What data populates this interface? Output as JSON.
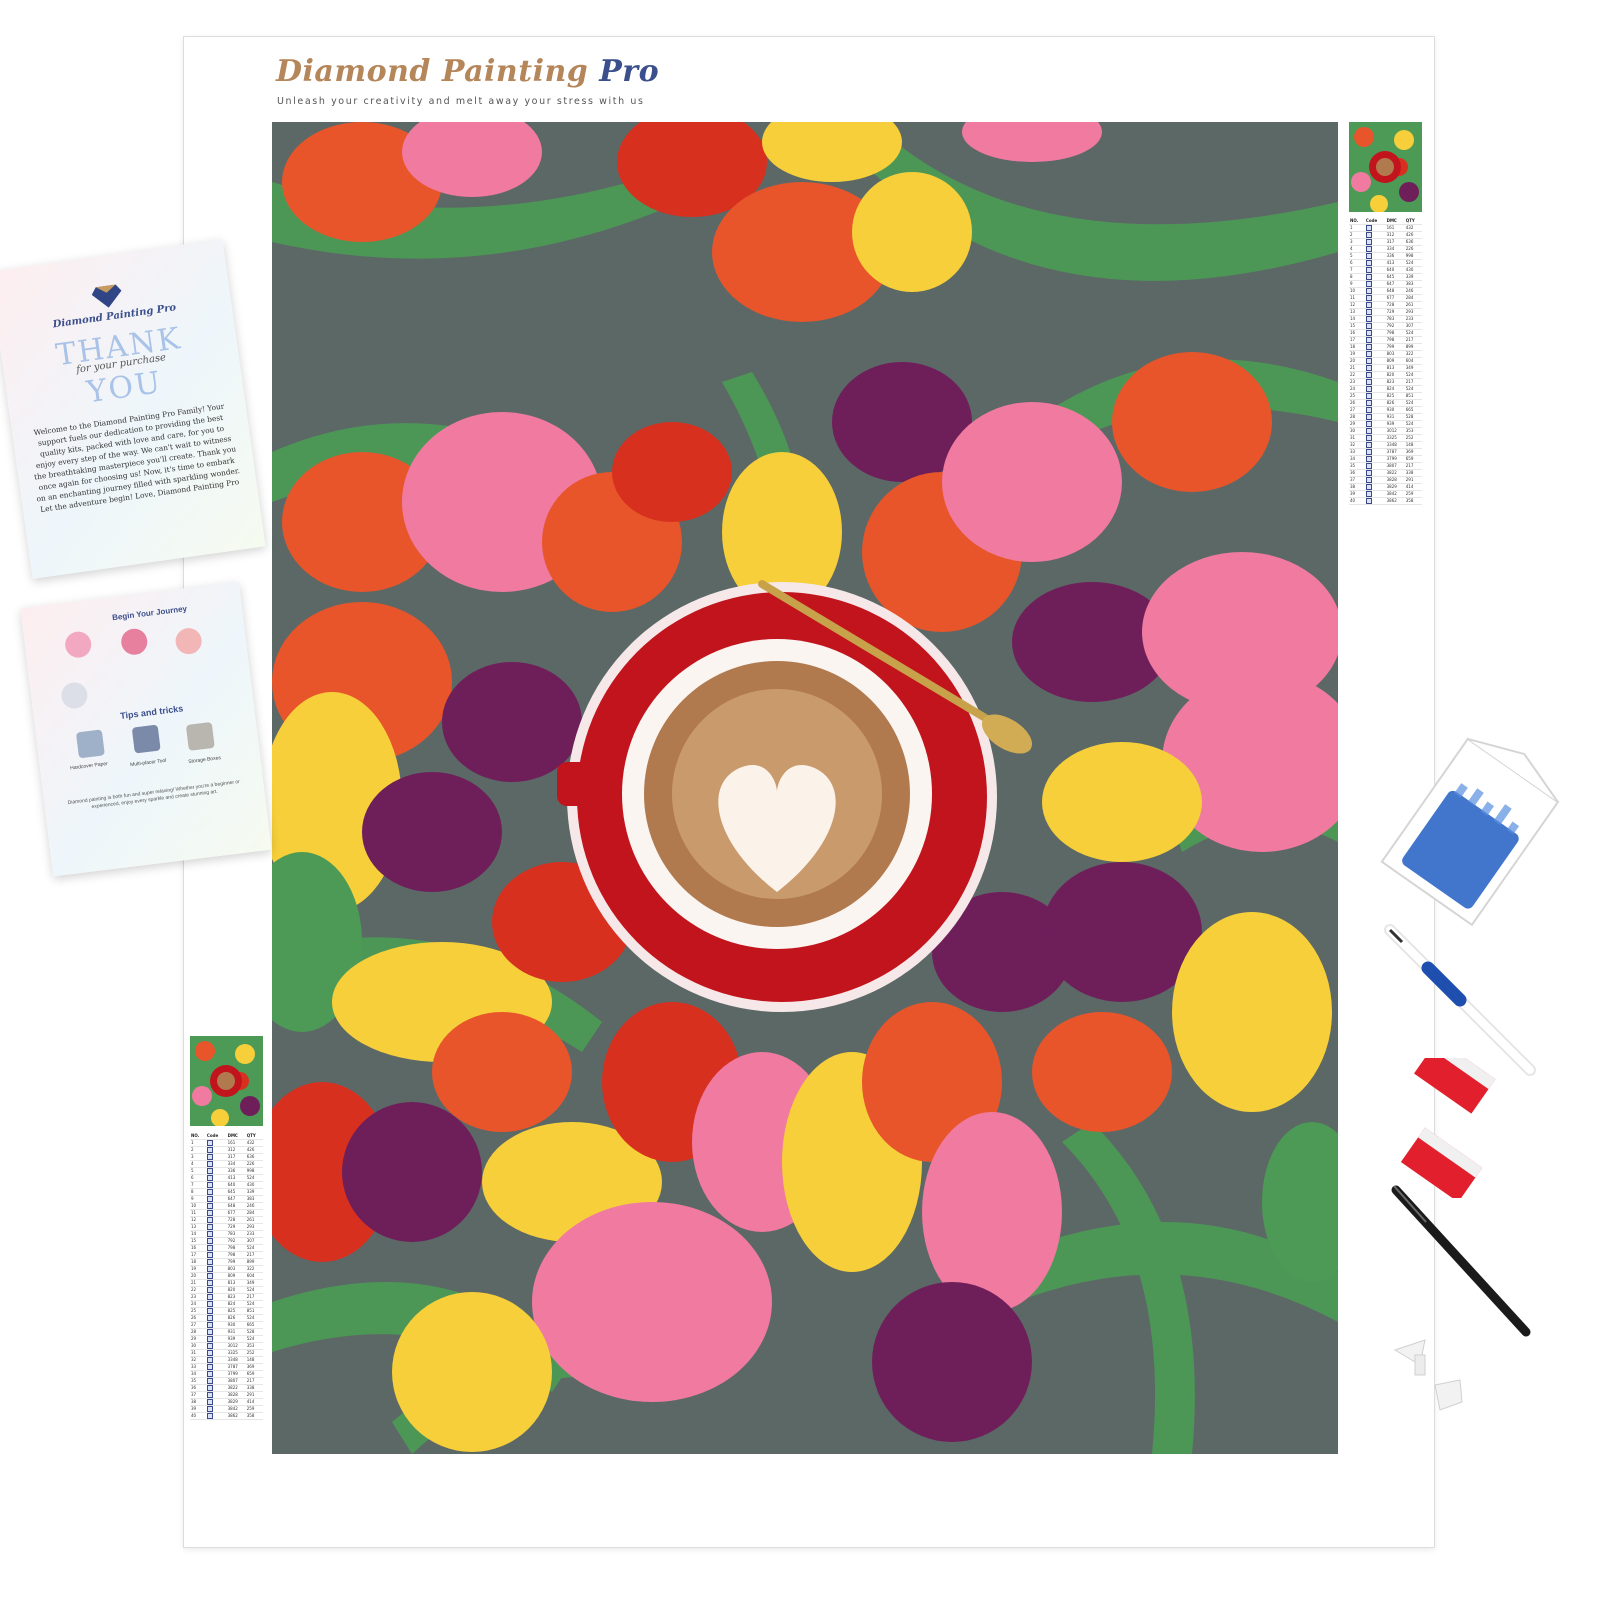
{
  "brand": {
    "name_main": "Diamond Painting ",
    "name_accent": "Pro",
    "tagline": "Unleash your creativity and melt away your stress with us",
    "colors": {
      "gold": "#b5865a",
      "navy": "#3b4f8c"
    }
  },
  "artwork": {
    "subject_icon": "coffee-cup-tulips-icon",
    "colors": {
      "red": "#d7301f",
      "pink": "#f07aa0",
      "yellow": "#f6cf3a",
      "orange": "#e8552a",
      "purple": "#6e1f5a",
      "leaf": "#3f8a4a",
      "saucer": "#c2141c",
      "coffee": "#b07a4e"
    }
  },
  "legend": {
    "headers": [
      "NO.",
      "Code",
      "DMC",
      "QTY"
    ],
    "rows": [
      [
        "1",
        "",
        "161",
        "432"
      ],
      [
        "2",
        "",
        "312",
        "426"
      ],
      [
        "3",
        "",
        "317",
        "636"
      ],
      [
        "4",
        "",
        "334",
        "226"
      ],
      [
        "5",
        "",
        "336",
        "998"
      ],
      [
        "6",
        "",
        "413",
        "524"
      ],
      [
        "7",
        "",
        "640",
        "430"
      ],
      [
        "8",
        "",
        "645",
        "339"
      ],
      [
        "9",
        "",
        "647",
        "383"
      ],
      [
        "10",
        "",
        "648",
        "246"
      ],
      [
        "11",
        "",
        "677",
        "284"
      ],
      [
        "12",
        "",
        "728",
        "261"
      ],
      [
        "13",
        "",
        "729",
        "293"
      ],
      [
        "14",
        "",
        "783",
        "233"
      ],
      [
        "15",
        "",
        "792",
        "307"
      ],
      [
        "16",
        "",
        "798",
        "524"
      ],
      [
        "17",
        "",
        "798",
        "217"
      ],
      [
        "18",
        "",
        "799",
        "899"
      ],
      [
        "19",
        "",
        "803",
        "322"
      ],
      [
        "20",
        "",
        "809",
        "604"
      ],
      [
        "21",
        "",
        "813",
        "349"
      ],
      [
        "22",
        "",
        "820",
        "524"
      ],
      [
        "23",
        "",
        "823",
        "217"
      ],
      [
        "24",
        "",
        "824",
        "524"
      ],
      [
        "25",
        "",
        "825",
        "851"
      ],
      [
        "26",
        "",
        "826",
        "524"
      ],
      [
        "27",
        "",
        "930",
        "665"
      ],
      [
        "28",
        "",
        "931",
        "528"
      ],
      [
        "29",
        "",
        "939",
        "524"
      ],
      [
        "30",
        "",
        "3012",
        "353"
      ],
      [
        "31",
        "",
        "3325",
        "252"
      ],
      [
        "32",
        "",
        "3348",
        "148"
      ],
      [
        "33",
        "",
        "3787",
        "369"
      ],
      [
        "34",
        "",
        "3799",
        "659"
      ],
      [
        "35",
        "",
        "3807",
        "217"
      ],
      [
        "36",
        "",
        "3822",
        "338"
      ],
      [
        "37",
        "",
        "3828",
        "291"
      ],
      [
        "38",
        "",
        "3829",
        "414"
      ],
      [
        "39",
        "",
        "3842",
        "259"
      ],
      [
        "40",
        "",
        "3862",
        "358"
      ]
    ]
  },
  "card_thanks": {
    "brand": "Diamond Painting Pro",
    "thank": "THANK",
    "for_purchase": "for your purchase",
    "you": "YOU",
    "message": "Welcome to the Diamond Painting Pro Family! Your support fuels our dedication to providing the best quality kits, packed with love and care, for you to enjoy every step of the way. We can't wait to witness the breathtaking masterpiece you'll create. Thank you once again for choosing us! Now, it's time to embark on an enchanting journey filled with sparkling wonder. Let the adventure begin! Love, Diamond Painting Pro"
  },
  "card_guide": {
    "heading": "Begin Your Journey",
    "tips_heading": "Tips and tricks",
    "labels": [
      "Hardcover Paper",
      "Multi-placer Tool",
      "Storage Boxes"
    ],
    "body": "Diamond painting is both fun and super relaxing! Whether you're a beginner or experienced, enjoy every sparkle and create stunning art."
  },
  "tools": [
    "diamond-tray-icon",
    "drill-pen-icon",
    "wax-pad-icon",
    "tweezers-icon",
    "pen-heads-icon"
  ]
}
